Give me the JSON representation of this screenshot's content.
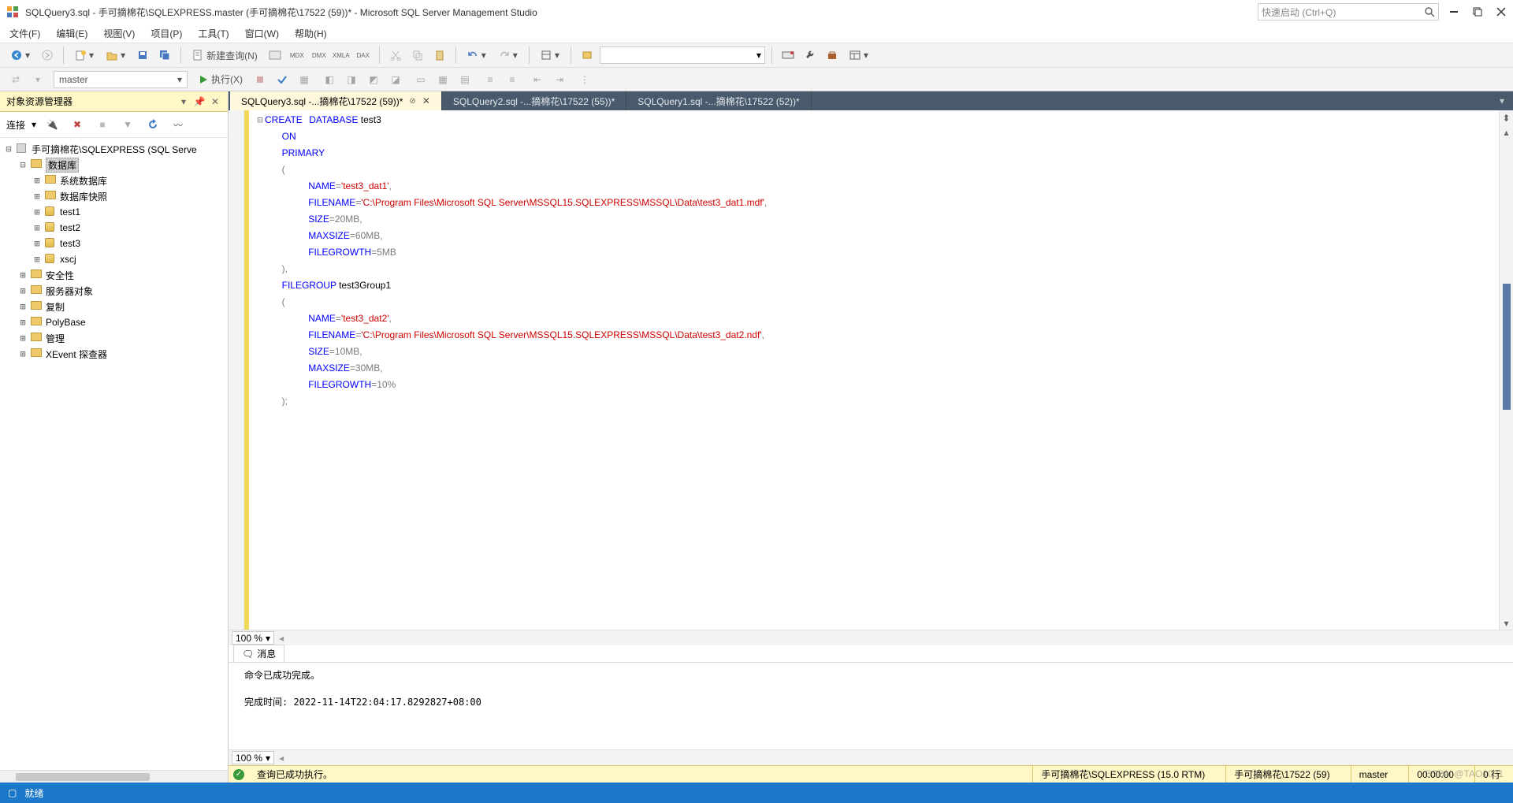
{
  "title": "SQLQuery3.sql - 手可摘棉花\\SQLEXPRESS.master (手可摘棉花\\17522 (59))* - Microsoft SQL Server Management Studio",
  "quick_launch_placeholder": "快速启动 (Ctrl+Q)",
  "menu": [
    "文件(F)",
    "编辑(E)",
    "视图(V)",
    "项目(P)",
    "工具(T)",
    "窗口(W)",
    "帮助(H)"
  ],
  "toolbar1": {
    "new_query": "新建查询(N)"
  },
  "toolbar2": {
    "db": "master",
    "execute": "执行(X)"
  },
  "sidebar": {
    "title": "对象资源管理器",
    "conn_label": "连接",
    "root": "手可摘棉花\\SQLEXPRESS (SQL Serve",
    "nodes": [
      {
        "label": "数据库",
        "level": 1,
        "selected": true,
        "icon": "folder",
        "exp": "⊟"
      },
      {
        "label": "系统数据库",
        "level": 2,
        "icon": "folder",
        "exp": "⊞"
      },
      {
        "label": "数据库快照",
        "level": 2,
        "icon": "folder",
        "exp": "⊞"
      },
      {
        "label": "test1",
        "level": 2,
        "icon": "db",
        "exp": "⊞"
      },
      {
        "label": "test2",
        "level": 2,
        "icon": "db",
        "exp": "⊞"
      },
      {
        "label": "test3",
        "level": 2,
        "icon": "db",
        "exp": "⊞"
      },
      {
        "label": "xscj",
        "level": 2,
        "icon": "db",
        "exp": "⊞"
      },
      {
        "label": "安全性",
        "level": 1,
        "icon": "folder",
        "exp": "⊞"
      },
      {
        "label": "服务器对象",
        "level": 1,
        "icon": "folder",
        "exp": "⊞"
      },
      {
        "label": "复制",
        "level": 1,
        "icon": "folder",
        "exp": "⊞"
      },
      {
        "label": "PolyBase",
        "level": 1,
        "icon": "folder",
        "exp": "⊞"
      },
      {
        "label": "管理",
        "level": 1,
        "icon": "folder",
        "exp": "⊞"
      },
      {
        "label": "XEvent 探查器",
        "level": 1,
        "icon": "folder",
        "exp": "⊞"
      }
    ]
  },
  "tabs": [
    {
      "label": "SQLQuery3.sql -...摘棉花\\17522 (59))*",
      "active": true,
      "closable": true
    },
    {
      "label": "SQLQuery2.sql -...摘棉花\\17522 (55))*",
      "active": false
    },
    {
      "label": "SQLQuery1.sql -...摘棉花\\17522 (52))*",
      "active": false
    }
  ],
  "sql": {
    "l1_kw1": "CREATE",
    "l1_kw2": "DATABASE",
    "l1_id": " test3",
    "l2": "ON",
    "l3": "PRIMARY",
    "l4": "(",
    "l5_kw": "NAME",
    "l5_eq": "=",
    "l5_str": "'test3_dat1'",
    "l5_comma": ",",
    "l6_kw": "FILENAME",
    "l6_eq": "=",
    "l6_str": "'C:\\Program Files\\Microsoft SQL Server\\MSSQL15.SQLEXPRESS\\MSSQL\\Data\\test3_dat1.mdf'",
    "l6_comma": ",",
    "l7_kw": "SIZE",
    "l7_rest": "=20MB,",
    "l8_kw": "MAXSIZE",
    "l8_rest": "=60MB,",
    "l9_kw": "FILEGROWTH",
    "l9_rest": "=5MB",
    "l10": "),",
    "l11_kw": "FILEGROUP",
    "l11_id": " test3Group1",
    "l12": "(",
    "l13_kw": "NAME",
    "l13_eq": "=",
    "l13_str": "'test3_dat2'",
    "l13_comma": ",",
    "l14_kw": "FILENAME",
    "l14_eq": "=",
    "l14_str": "'C:\\Program Files\\Microsoft SQL Server\\MSSQL15.SQLEXPRESS\\MSSQL\\Data\\test3_dat2.ndf'",
    "l14_comma": ",",
    "l15_kw": "SIZE",
    "l15_rest": "=10MB,",
    "l16_kw": "MAXSIZE",
    "l16_rest": "=30MB,",
    "l17_kw": "FILEGROWTH",
    "l17_rest": "=10",
    "l17_gray": "%",
    "l18": ");"
  },
  "zoom": "100 %",
  "messages": {
    "tab": "消息",
    "line1": "命令已成功完成。",
    "line2": "完成时间: 2022-11-14T22:04:17.8292827+08:00"
  },
  "status": {
    "exec": "查询已成功执行。",
    "server": "手可摘棉花\\SQLEXPRESS (15.0 RTM)",
    "user": "手可摘棉花\\17522 (59)",
    "db": "master",
    "time": "00:00:00",
    "rows": "0 行"
  },
  "bottom": {
    "ready": "就绪"
  },
  "watermark": "CSDN @TAO1031"
}
